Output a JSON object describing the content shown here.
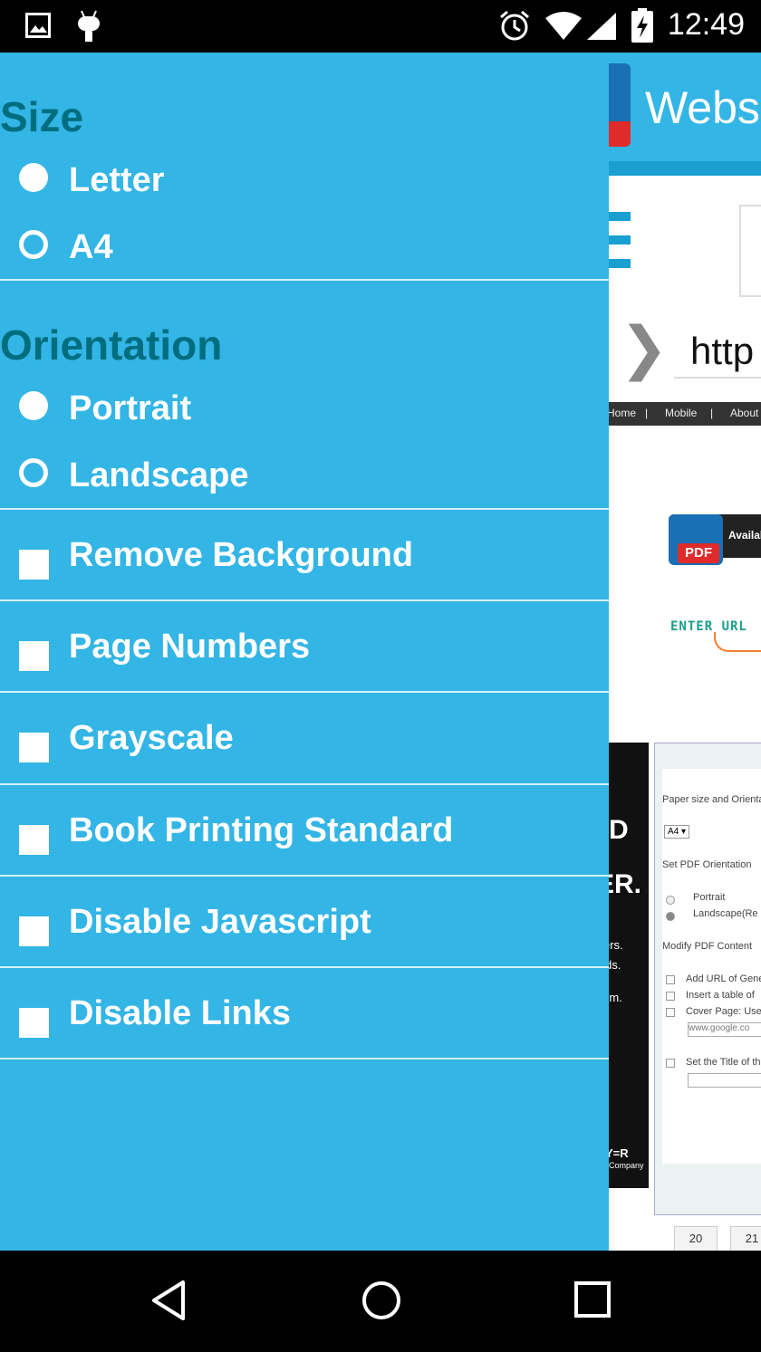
{
  "status_bar": {
    "time": "12:49",
    "icons": [
      "image-icon",
      "android-debug-icon",
      "alarm-icon",
      "wifi-icon",
      "cell-signal-icon",
      "battery-charging-icon"
    ]
  },
  "background_app": {
    "title": "Webs",
    "url_prefix": "http",
    "nav_links": [
      "Home",
      "|",
      "Mobile",
      "|",
      "About U"
    ],
    "badge_text": "Availal",
    "pdf_label": "PDF",
    "enter_url": "ENTER URL",
    "dark_panel_text": [
      "D",
      "ER.",
      "ers.",
      "ds.",
      "rm.",
      "Y=R",
      "Company"
    ],
    "settings_panel": {
      "paper_label": "Paper size and Orienta",
      "paper_value": "A4",
      "orientation_label": "Set PDF Orientation",
      "portrait": "Portrait",
      "landscape": "Landscape(Re",
      "modify_label": "Modify PDF Content",
      "opt1": "Add URL of Gene",
      "opt2": "Insert a table of",
      "opt3": "Cover Page: Use",
      "cover_placeholder": "www.google.co",
      "opt4": "Set the Title of th"
    },
    "pages": [
      "20",
      "21"
    ]
  },
  "drawer": {
    "size_title": "Size",
    "size_options": [
      {
        "label": "Letter",
        "selected": false
      },
      {
        "label": "A4",
        "selected": true
      }
    ],
    "orientation_title": "Orientation",
    "orientation_options": [
      {
        "label": "Portrait",
        "selected": false
      },
      {
        "label": "Landscape",
        "selected": true
      }
    ],
    "checkboxes": [
      {
        "label": "Remove Background",
        "checked": false
      },
      {
        "label": "Page Numbers",
        "checked": false
      },
      {
        "label": "Grayscale",
        "checked": false
      },
      {
        "label": "Book Printing Standard",
        "checked": false
      },
      {
        "label": "Disable Javascript",
        "checked": false
      },
      {
        "label": "Disable Links",
        "checked": false
      }
    ]
  },
  "nav_bar": {
    "buttons": [
      "back-icon",
      "home-icon",
      "recents-icon"
    ]
  },
  "colors": {
    "drawer_bg": "#33b5e5",
    "section_title": "#006e7f",
    "label": "#ffffff"
  }
}
